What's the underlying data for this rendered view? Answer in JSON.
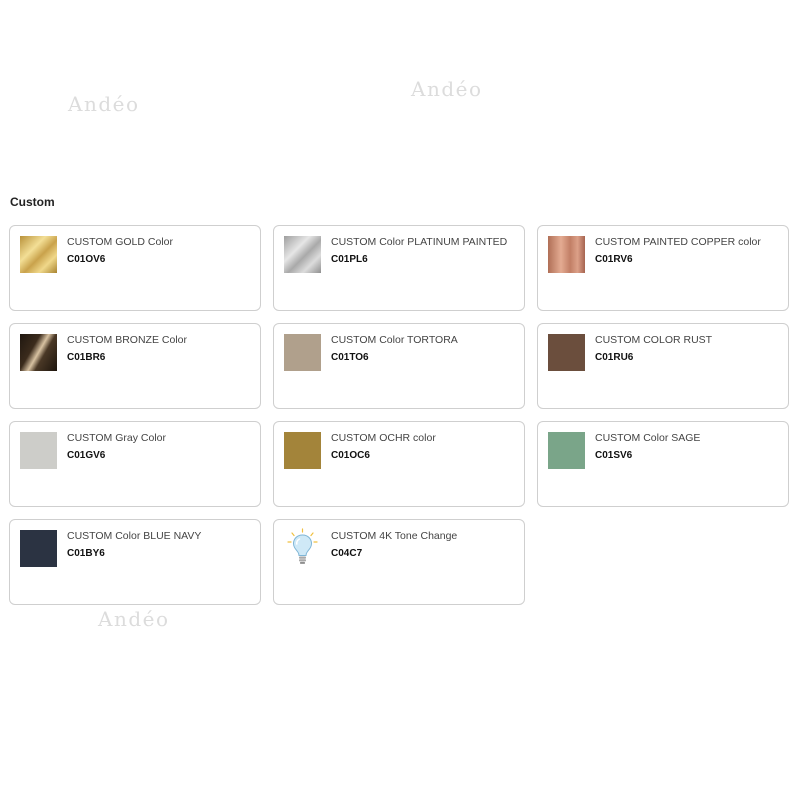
{
  "watermarks": [
    "Andéo",
    "Andéo",
    "Andéo"
  ],
  "section": {
    "title": "Custom"
  },
  "items": [
    {
      "name": "CUSTOM GOLD Color",
      "code": "C01OV6",
      "swatch": "gold-finish"
    },
    {
      "name": "CUSTOM Color PLATINUM PAINTED",
      "code": "C01PL6",
      "swatch": "platinum-finish"
    },
    {
      "name": "CUSTOM PAINTED COPPER color",
      "code": "C01RV6",
      "swatch": "copper-finish"
    },
    {
      "name": "CUSTOM BRONZE Color",
      "code": "C01BR6",
      "swatch": "bronze-finish"
    },
    {
      "name": "CUSTOM Color TORTORA",
      "code": "C01TO6",
      "swatch": "#b0a08c"
    },
    {
      "name": "CUSTOM COLOR RUST",
      "code": "C01RU6",
      "swatch": "#6b4e3d"
    },
    {
      "name": "CUSTOM Gray Color",
      "code": "C01GV6",
      "swatch": "#cdcdc9"
    },
    {
      "name": "CUSTOM OCHR color",
      "code": "C01OC6",
      "swatch": "#a3843a"
    },
    {
      "name": "CUSTOM Color SAGE",
      "code": "C01SV6",
      "swatch": "#7aa589"
    },
    {
      "name": "CUSTOM Color BLUE NAVY",
      "code": "C01BY6",
      "swatch": "#2b3342"
    },
    {
      "name": "CUSTOM 4K Tone Change",
      "code": "C04C7",
      "swatch": "lightbulb-icon"
    }
  ]
}
